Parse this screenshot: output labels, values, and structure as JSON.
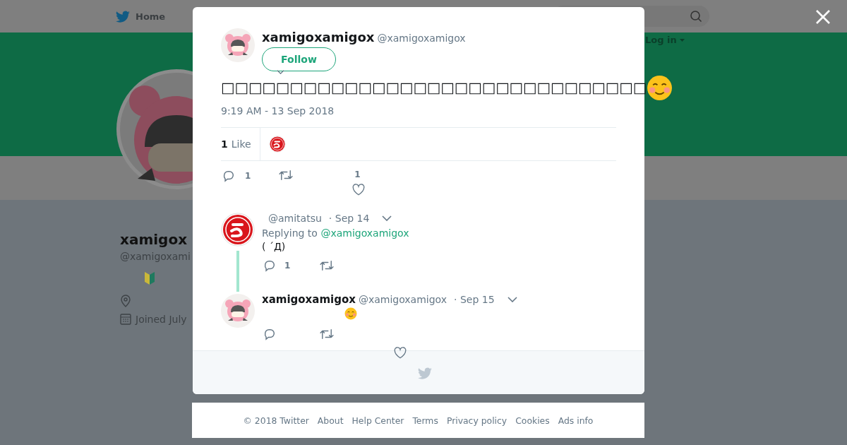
{
  "background_page": {
    "nav_home": "Home",
    "login": "Log in",
    "profile": {
      "name": "xamigox",
      "handle": "@xamigoxami",
      "joined": "Joined July"
    }
  },
  "tweet": {
    "name": "xamigoxamigox",
    "handle": "@xamigoxamigox",
    "follow": "Follow",
    "text": "□□□□□□□□□□□□□□□□□□□□□□□□□□□□□□□",
    "time": "9:19 AM - 13 Sep 2018",
    "likes_count": "1",
    "likes_label": "Like",
    "reply_count": "1",
    "like_count": "1"
  },
  "replies": [
    {
      "kind": "red-mark",
      "handle": "@amitatsu",
      "date": "· Sep 14",
      "replying_label": "Replying to",
      "replying_to": "@xamigoxamigox",
      "text": "( ´Д)",
      "reply_count": "1"
    },
    {
      "kind": "character",
      "name": "xamigoxamigox",
      "handle": "@xamigoxamigox",
      "date": "· Sep 15"
    }
  ],
  "footer": [
    "© 2018 Twitter",
    "About",
    "Help Center",
    "Terms",
    "Privacy policy",
    "Cookies",
    "Ads info"
  ]
}
